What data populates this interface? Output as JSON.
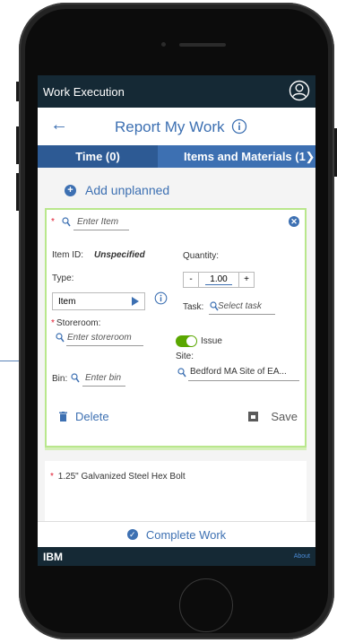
{
  "app": {
    "title": "Work Execution",
    "header_title": "Report My Work"
  },
  "tabs": [
    {
      "label": "Time (0)"
    },
    {
      "label": "Items and Materials (1"
    }
  ],
  "add_unplanned": "Add unplanned",
  "item_card": {
    "item_placeholder": "Enter Item",
    "item_id_label": "Item ID:",
    "item_id_value": "Unspecified",
    "quantity_label": "Quantity:",
    "quantity_minus": "-",
    "quantity_value": "1.00",
    "quantity_plus": "+",
    "type_label": "Type:",
    "type_value": "Item",
    "task_label": "Task:",
    "task_placeholder": "Select task",
    "storeroom_label": "Storeroom:",
    "storeroom_placeholder": "Enter storeroom",
    "issue_label": "Issue",
    "issue_on": true,
    "site_label": "Site:",
    "site_value": "Bedford MA Site of EA...",
    "bin_label": "Bin:",
    "bin_placeholder": "Enter bin",
    "delete_label": "Delete",
    "save_label": "Save"
  },
  "second_card": {
    "item_description": "1.25\" Galvanized Steel Hex Bolt"
  },
  "complete_work_label": "Complete Work",
  "footer": {
    "brand": "IBM",
    "about": "About"
  },
  "icons": [
    "profile-icon",
    "back-arrow-icon",
    "info-icon",
    "chevron-right-icon",
    "plus-icon",
    "close-icon",
    "search-icon",
    "play-arrow-icon",
    "trash-icon",
    "save-icon",
    "check-icon"
  ],
  "colors": {
    "app_bar": "#152935",
    "accent": "#3d70b2",
    "card_border": "#b9e78c",
    "toggle_on": "#5aa700",
    "required": "#e0182d"
  }
}
